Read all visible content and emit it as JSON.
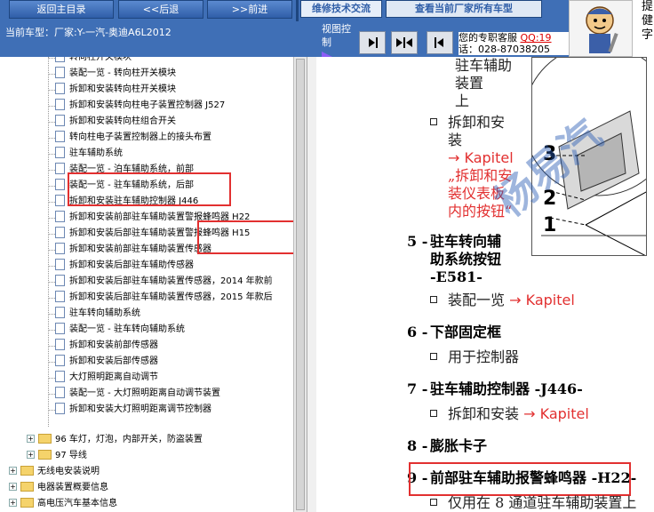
{
  "topbar": {
    "back_home": "返回主目录",
    "back": "<<后退",
    "forward": ">>前进",
    "tab_repair": "维修技术交流",
    "tab_check": "查看当前厂家所有车型"
  },
  "current_car": "当前车型：厂家:Y-一汽-奥迪A6L2012",
  "view_control": "视图控制",
  "support": {
    "label": "您的专职客服",
    "qq": "QQ:19",
    "phone": "话：028-87038205"
  },
  "mascot_note": "提健字",
  "tree": {
    "items": [
      {
        "label": "转向柱开关模块",
        "type": "doc"
      },
      {
        "label": "装配一览 - 转向柱开关模块",
        "type": "doc"
      },
      {
        "label": "拆卸和安装转向柱开关模块",
        "type": "doc"
      },
      {
        "label": "拆卸和安装转向柱电子装置控制器 J527",
        "type": "doc"
      },
      {
        "label": "拆卸和安装转向柱组合开关",
        "type": "doc"
      },
      {
        "label": "转向柱电子装置控制器上的接头布置",
        "type": "doc"
      },
      {
        "label": "驻车辅助系统",
        "type": "doc"
      },
      {
        "label": "装配一览 - 泊车辅助系统，前部",
        "type": "doc"
      },
      {
        "label": "装配一览 - 驻车辅助系统，后部",
        "type": "doc"
      },
      {
        "label": "拆卸和安装驻车辅助控制器 J446",
        "type": "doc"
      },
      {
        "label": "拆卸和安装前部驻车辅助装置警报蜂鸣器 H22",
        "type": "doc"
      },
      {
        "label": "拆卸和安装后部驻车辅助装置警报蜂鸣器 H15",
        "type": "doc"
      },
      {
        "label": "拆卸和安装前部驻车辅助装置传感器",
        "type": "doc"
      },
      {
        "label": "拆卸和安装后部驻车辅助传感器",
        "type": "doc"
      },
      {
        "label": "拆卸和安装后部驻车辅助装置传感器，2014 年款前",
        "type": "doc"
      },
      {
        "label": "拆卸和安装后部驻车辅助装置传感器，2015 年款后",
        "type": "doc"
      },
      {
        "label": "驻车转向辅助系统",
        "type": "doc"
      },
      {
        "label": "装配一览 - 驻车转向辅助系统",
        "type": "doc"
      },
      {
        "label": "拆卸和安装前部传感器",
        "type": "doc"
      },
      {
        "label": "拆卸和安装后部传感器",
        "type": "doc"
      },
      {
        "label": "大灯照明距离自动调节",
        "type": "doc"
      },
      {
        "label": "装配一览 - 大灯照明距离自动调节装置",
        "type": "doc"
      },
      {
        "label": "拆卸和安装大灯照明距离调节控制器",
        "type": "doc"
      }
    ],
    "folders": [
      {
        "label": "96 车灯，灯泡，内部开关，防盗装置"
      },
      {
        "label": "97 导线"
      },
      {
        "label": "无线电安装说明"
      },
      {
        "label": "电器装置概要信息"
      },
      {
        "label": "高电压汽车基本信息"
      }
    ]
  },
  "document": {
    "sub1": [
      "驻车辅助",
      "装置",
      "上"
    ],
    "remove_install": "拆卸和安",
    "remove_install_2": "装",
    "kapitel": "→ Kapitel",
    "link_lines": [
      "„拆卸和安",
      "装仪表板",
      "内的按钮“"
    ],
    "items": [
      {
        "num": "5 -",
        "title_lines": [
          "驻车转向辅",
          "助系统按钮",
          "-E581-"
        ],
        "sub": "装配一览",
        "sub_link": "→ Kapitel"
      },
      {
        "num": "6 -",
        "title_lines": [
          "下部固定框"
        ],
        "sub": "用于控制器"
      },
      {
        "num": "7 -",
        "title_lines": [
          "驻车辅助控制器 -J446-"
        ],
        "sub": "拆卸和安装",
        "sub_link": "→ Kapitel"
      },
      {
        "num": "8 -",
        "title_lines": [
          "膨胀卡子"
        ]
      },
      {
        "num": "9 -",
        "title_lines": [
          "前部驻车辅助报警蜂鸣器 -H22-"
        ],
        "sub": "仅用在 8 通道驻车辅助装置上"
      }
    ],
    "figure_numbers": [
      "3",
      "2",
      "1"
    ],
    "watermark": "杨易汽"
  }
}
